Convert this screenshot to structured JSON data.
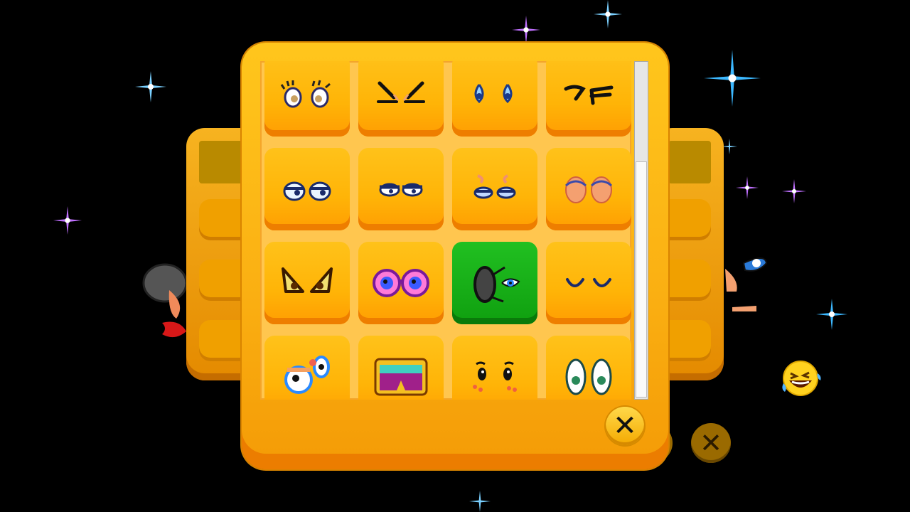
{
  "screen": {
    "title": "",
    "background_color": "#000000"
  },
  "panel": {
    "colors": {
      "tile": "#ffb407",
      "tile_shadow": "#ee7e00",
      "selected_tile": "#18b018",
      "panel": "#fbb113"
    },
    "close_label": "✕",
    "scroll_position": 0.35,
    "selected_index": 10,
    "items": [
      {
        "icon": "lashed-eyes-icon"
      },
      {
        "icon": "squinting-eyes-icon"
      },
      {
        "icon": "teary-eyes-icon"
      },
      {
        "icon": "zigzag-eyes-icon"
      },
      {
        "icon": "bored-eyes-icon"
      },
      {
        "icon": "half-closed-eyes-icon"
      },
      {
        "icon": "sleepy-eyes-icon"
      },
      {
        "icon": "closed-eyelids-icon"
      },
      {
        "icon": "angry-eyes-icon"
      },
      {
        "icon": "purple-glasses-icon"
      },
      {
        "icon": "eyepatch-icon"
      },
      {
        "icon": "happy-closed-eyes-icon"
      },
      {
        "icon": "googly-eyes-icon"
      },
      {
        "icon": "ski-goggles-icon"
      },
      {
        "icon": "cute-eyes-icon"
      },
      {
        "icon": "big-round-eyes-icon"
      }
    ]
  },
  "background_close_label": "✕"
}
